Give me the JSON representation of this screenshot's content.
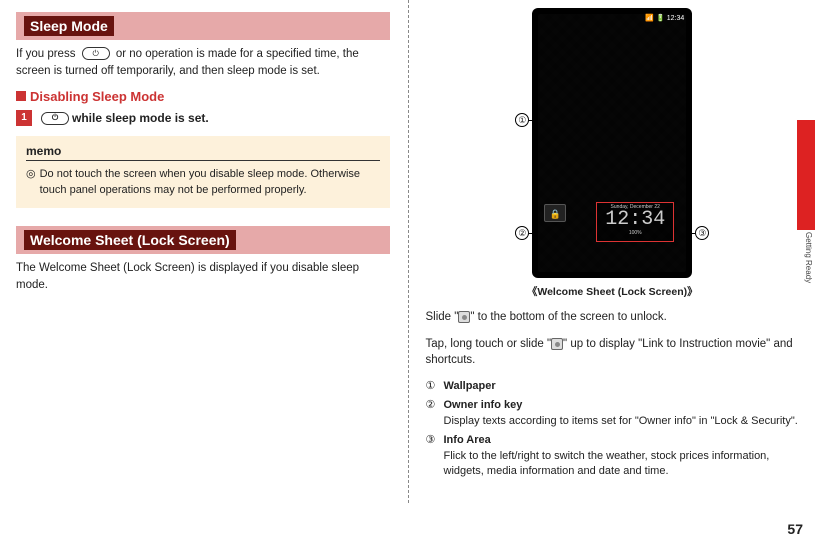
{
  "left": {
    "sleep_mode_title": "Sleep Mode",
    "sleep_mode_body_a": "If you press ",
    "sleep_mode_body_b": " or no operation is made for a specified time, the screen is turned off temporarily, and then sleep mode is set.",
    "disable_title": "Disabling Sleep Mode",
    "step_num": "1",
    "step_text": " while sleep mode is set.",
    "memo_label": "memo",
    "memo_bullet": "◎",
    "memo_text": "Do not touch the screen when you disable sleep mode. Otherwise touch panel operations may not be performed properly.",
    "welcome_title": "Welcome Sheet (Lock Screen)",
    "welcome_body": "The Welcome Sheet (Lock Screen) is displayed if you disable sleep mode."
  },
  "right": {
    "status_time": "12:34",
    "lock_date": "Sunday, December 22",
    "lock_clock": "12:34",
    "lock_batt": "100%",
    "call1": "①",
    "call2": "②",
    "call3": "③",
    "caption": "《Welcome Sheet (Lock Screen)》",
    "slide_a": "Slide \"",
    "slide_b": "\" to the bottom of the screen to unlock.",
    "tap_a": "Tap, long touch or slide \"",
    "tap_b": "\" up to display \"Link to Instruction movie\" and shortcuts.",
    "items": [
      {
        "num": "①",
        "title": "Wallpaper",
        "desc": ""
      },
      {
        "num": "②",
        "title": "Owner info key",
        "desc": "Display texts according to items set for \"Owner info\" in \"Lock & Security\"."
      },
      {
        "num": "③",
        "title": "Info Area",
        "desc": "Flick to the left/right to switch the weather, stock prices information, widgets, media information and date and time."
      }
    ]
  },
  "chrome": {
    "side_label": "Getting Ready",
    "page_number": "57",
    "power_glyph": "⏻",
    "lock_glyph": "🔒"
  }
}
